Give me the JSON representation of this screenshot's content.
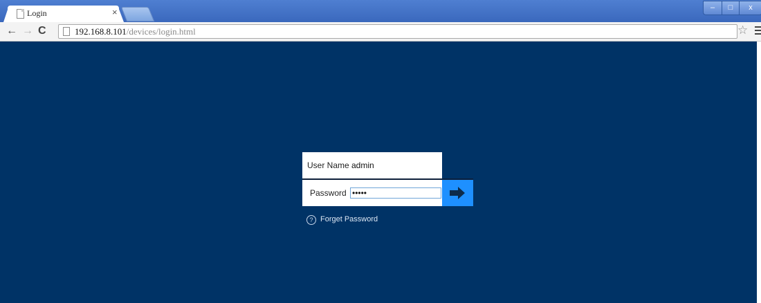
{
  "browser": {
    "tab": {
      "title": "Login",
      "close": "×"
    },
    "controls": {
      "minimize": "–",
      "maximize": "□",
      "close": "x"
    },
    "nav": {
      "back": "←",
      "forward": "→",
      "reload": "C"
    },
    "url": {
      "host": "192.168.8.101",
      "path": "/devices/login.html"
    },
    "bookmark_icon": "☆"
  },
  "login": {
    "username_label": "User Name",
    "username_value": "admin",
    "password_label": "Password",
    "password_value": "admin",
    "forget_label": "Forget Password",
    "help_glyph": "?"
  },
  "colors": {
    "background": "#003366",
    "submit": "#1e90ff",
    "titlebar": "#4575c9"
  },
  "icons": {
    "submit": "arrow-right-icon",
    "help": "question-circle-icon"
  }
}
